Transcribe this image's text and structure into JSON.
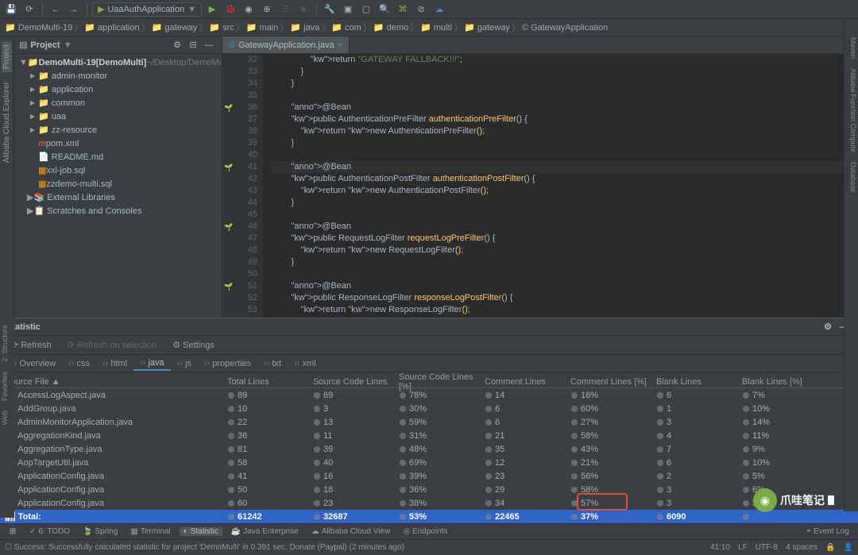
{
  "toolbar": {
    "runConfig": "UaaAuthApplication"
  },
  "breadcrumb": [
    "DemoMulti-19",
    "application",
    "gateway",
    "src",
    "main",
    "java",
    "com",
    "demo",
    "multi",
    "gateway",
    "GatewayApplication"
  ],
  "projectPanel": {
    "title": "Project"
  },
  "tree": {
    "root": {
      "name": "DemoMulti-19",
      "bold": "[DemoMulti]",
      "path": "~/Desktop/DemoMu..."
    },
    "items": [
      {
        "name": "admin-monitor",
        "icon": "dir",
        "arrow": "▶",
        "indent": 1
      },
      {
        "name": "application",
        "icon": "dir",
        "arrow": "▶",
        "indent": 1
      },
      {
        "name": "common",
        "icon": "dir",
        "arrow": "▶",
        "indent": 1
      },
      {
        "name": "uaa",
        "icon": "dir",
        "arrow": "▶",
        "indent": 1
      },
      {
        "name": "zz-resource",
        "icon": "dir",
        "arrow": "▶",
        "indent": 1
      },
      {
        "name": "pom.xml",
        "icon": "maven",
        "arrow": "",
        "indent": 1
      },
      {
        "name": "README.md",
        "icon": "md",
        "arrow": "",
        "indent": 1
      },
      {
        "name": "xxl-job.sql",
        "icon": "sql",
        "arrow": "",
        "indent": 1
      },
      {
        "name": "zzdemo-multi.sql",
        "icon": "sql",
        "arrow": "",
        "indent": 1
      }
    ],
    "external": "External Libraries",
    "scratches": "Scratches and Consoles"
  },
  "editor": {
    "tab": "GatewayApplication.java",
    "firstLine": 32,
    "code": [
      "                return \"GATEWAY FALLBACK!!!\";",
      "            }",
      "        }",
      "",
      "        @Bean",
      "        public AuthenticationPreFilter authenticationPreFilter() {",
      "            return new AuthenticationPreFilter();",
      "        }",
      "",
      "        @Bean",
      "        public AuthenticationPostFilter authenticationPostFilter() {",
      "            return new AuthenticationPostFilter();",
      "        }",
      "",
      "        @Bean",
      "        public RequestLogFilter requestLogPreFilter() {",
      "            return new RequestLogFilter();",
      "        }",
      "",
      "        @Bean",
      "        public ResponseLogFilter responseLogPostFilter() {",
      "            return new ResponseLogFilter();",
      "        }"
    ],
    "gutterIcons": {
      "36": "bean",
      "41": "bean",
      "46": "bean",
      "51": "bean"
    }
  },
  "statistic": {
    "title": "Statistic",
    "refresh": "Refresh",
    "refreshSel": "Refresh on selection",
    "settings": "Settings",
    "tabs": [
      "Overview",
      "css",
      "html",
      "java",
      "js",
      "properties",
      "txt",
      "xml"
    ],
    "activeTab": "java",
    "columns": [
      "Source File ▲",
      "Total Lines",
      "Source Code Lines",
      "Source Code Lines [%]",
      "Comment Lines",
      "Comment Lines [%]",
      "Blank Lines",
      "Blank Lines [%]"
    ],
    "rows": [
      {
        "f": "AccessLogAspect.java",
        "tl": "89",
        "sl": "69",
        "sp": "78%",
        "cl": "14",
        "cp": "16%",
        "bl": "6",
        "bp": "7%"
      },
      {
        "f": "AddGroup.java",
        "tl": "10",
        "sl": "3",
        "sp": "30%",
        "cl": "6",
        "cp": "60%",
        "bl": "1",
        "bp": "10%"
      },
      {
        "f": "AdminMonitorApplication.java",
        "tl": "22",
        "sl": "13",
        "sp": "59%",
        "cl": "6",
        "cp": "27%",
        "bl": "3",
        "bp": "14%"
      },
      {
        "f": "AggregationKind.java",
        "tl": "36",
        "sl": "11",
        "sp": "31%",
        "cl": "21",
        "cp": "58%",
        "bl": "4",
        "bp": "11%"
      },
      {
        "f": "AggregationType.java",
        "tl": "81",
        "sl": "39",
        "sp": "48%",
        "cl": "35",
        "cp": "43%",
        "bl": "7",
        "bp": "9%"
      },
      {
        "f": "AopTargetUtil.java",
        "tl": "58",
        "sl": "40",
        "sp": "69%",
        "cl": "12",
        "cp": "21%",
        "bl": "6",
        "bp": "10%"
      },
      {
        "f": "ApplicationConfig.java",
        "tl": "41",
        "sl": "16",
        "sp": "39%",
        "cl": "23",
        "cp": "56%",
        "bl": "2",
        "bp": "5%"
      },
      {
        "f": "ApplicationConfig.java",
        "tl": "50",
        "sl": "18",
        "sp": "36%",
        "cl": "29",
        "cp": "58%",
        "bl": "3",
        "bp": "6%"
      },
      {
        "f": "ApplicationConfig.java",
        "tl": "60",
        "sl": "23",
        "sp": "38%",
        "cl": "34",
        "cp": "57%",
        "bl": "3",
        "bp": "5%"
      }
    ],
    "total": {
      "f": "Total:",
      "tl": "61242",
      "sl": "32687",
      "sp": "53%",
      "cl": "22465",
      "cp": "37%",
      "bl": "6090",
      "bp": ""
    }
  },
  "bottomBar": {
    "todo": "6: TODO",
    "spring": "Spring",
    "terminal": "Terminal",
    "statistic": "Statistic",
    "javaee": "Java Enterprise",
    "alibaba": "Alibaba Cloud View",
    "endpoints": "Endpoints",
    "eventlog": "Event Log"
  },
  "status": {
    "msg": "Success: Successfully calculated statistic for project 'DemoMulti' in 0.391 sec. Donate (Paypal) (2 minutes ago)",
    "pos": "41:10",
    "lf": "LF",
    "enc": "UTF-8",
    "spaces": "4 spaces"
  },
  "sideLeft": [
    "Project",
    "Alibaba Cloud Explorer"
  ],
  "sideLeft2": [
    "2: Structure",
    "Favorites",
    "Web"
  ],
  "sideRight": [
    "Maven",
    "Alibaba Function Compute",
    "Database"
  ],
  "watermark": "爪哇笔记"
}
